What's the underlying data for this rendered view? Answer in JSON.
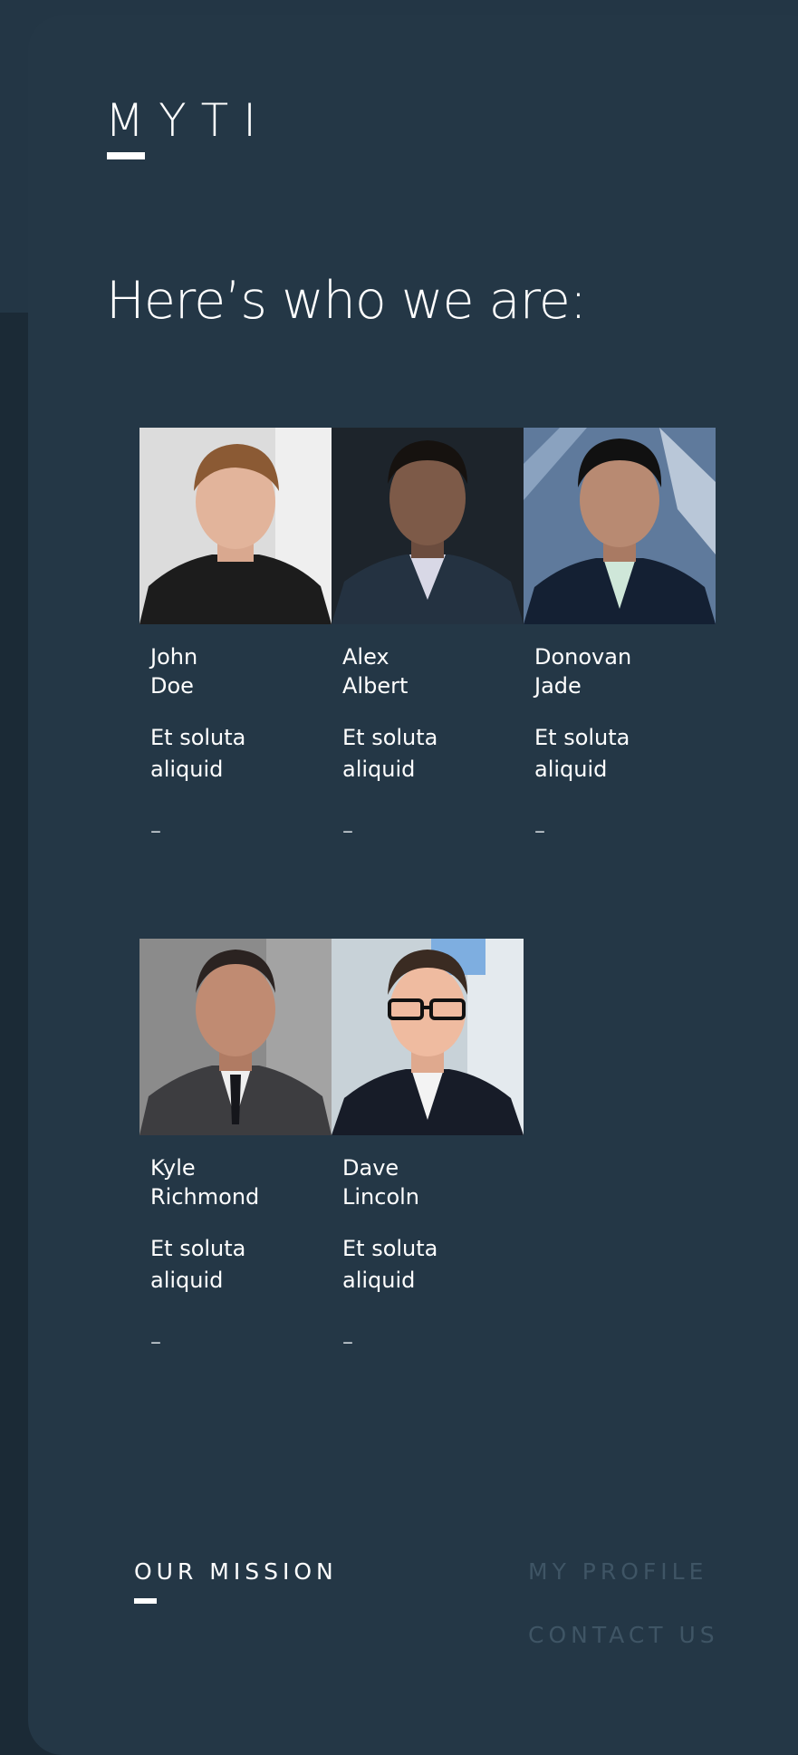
{
  "brand": {
    "logo_text": "MYTI"
  },
  "page": {
    "heading": "Here’s who we are:"
  },
  "team": [
    {
      "first": "John",
      "last": "Doe",
      "role_line1": "Et soluta",
      "role_line2": "aliquid",
      "dash": "–"
    },
    {
      "first": "Alex",
      "last": "Albert",
      "role_line1": "Et soluta",
      "role_line2": "aliquid",
      "dash": "–"
    },
    {
      "first": "Donovan",
      "last": "Jade",
      "role_line1": "Et soluta",
      "role_line2": "aliquid",
      "dash": "–"
    },
    {
      "first": "Kyle",
      "last": "Richmond",
      "role_line1": "Et soluta",
      "role_line2": "aliquid",
      "dash": "–"
    },
    {
      "first": "Dave",
      "last": "Lincoln",
      "role_line1": "Et soluta",
      "role_line2": "aliquid",
      "dash": "–"
    }
  ],
  "nav": {
    "mission": "OUR MISSION",
    "profile": "MY PROFILE",
    "contact": "CONTACT US"
  },
  "colors": {
    "background": "#1b2a36",
    "panel": "#243746",
    "text": "#ffffff",
    "muted_nav": "#3f5565"
  }
}
